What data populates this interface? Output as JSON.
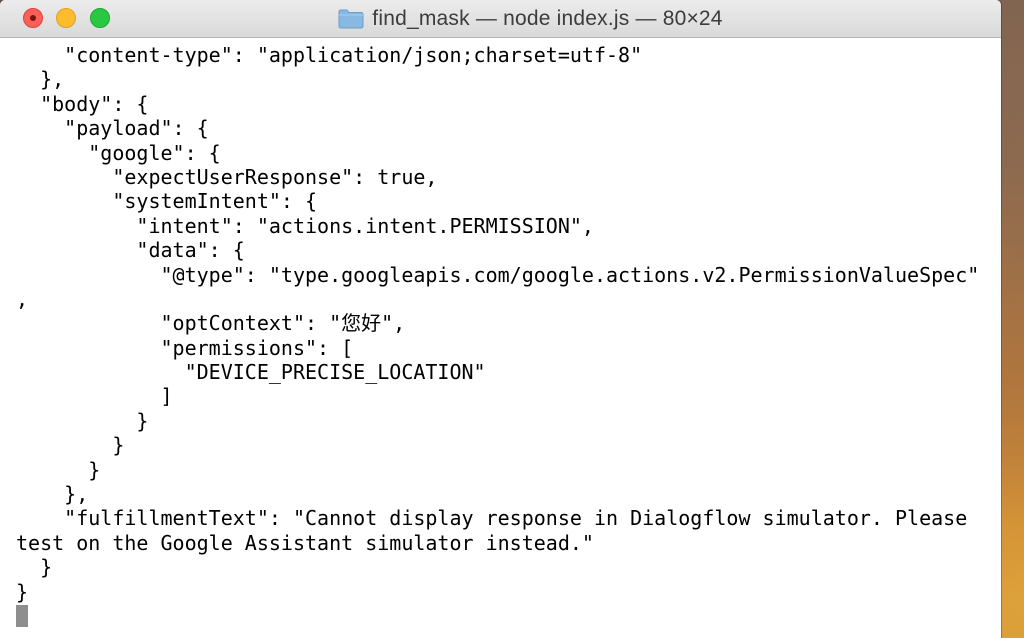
{
  "window": {
    "title": "find_mask — node index.js — 80×24",
    "folder_icon": "folder-icon",
    "colors": {
      "close": "#fc5f57",
      "minimize": "#fdbc2e",
      "zoom": "#28c840",
      "folder": "#87b9e3"
    }
  },
  "terminal": {
    "lines": [
      "    \"content-type\": \"application/json;charset=utf-8\"",
      "  },",
      "  \"body\": {",
      "    \"payload\": {",
      "      \"google\": {",
      "        \"expectUserResponse\": true,",
      "        \"systemIntent\": {",
      "          \"intent\": \"actions.intent.PERMISSION\",",
      "          \"data\": {",
      "            \"@type\": \"type.googleapis.com/google.actions.v2.PermissionValueSpec\"",
      ",",
      "            \"optContext\": \"您好\",",
      "            \"permissions\": [",
      "              \"DEVICE_PRECISE_LOCATION\"",
      "            ]",
      "          }",
      "        }",
      "      }",
      "    },",
      "    \"fulfillmentText\": \"Cannot display response in Dialogflow simulator. Please",
      "test on the Google Assistant simulator instead.\"",
      "  }",
      "}"
    ]
  }
}
